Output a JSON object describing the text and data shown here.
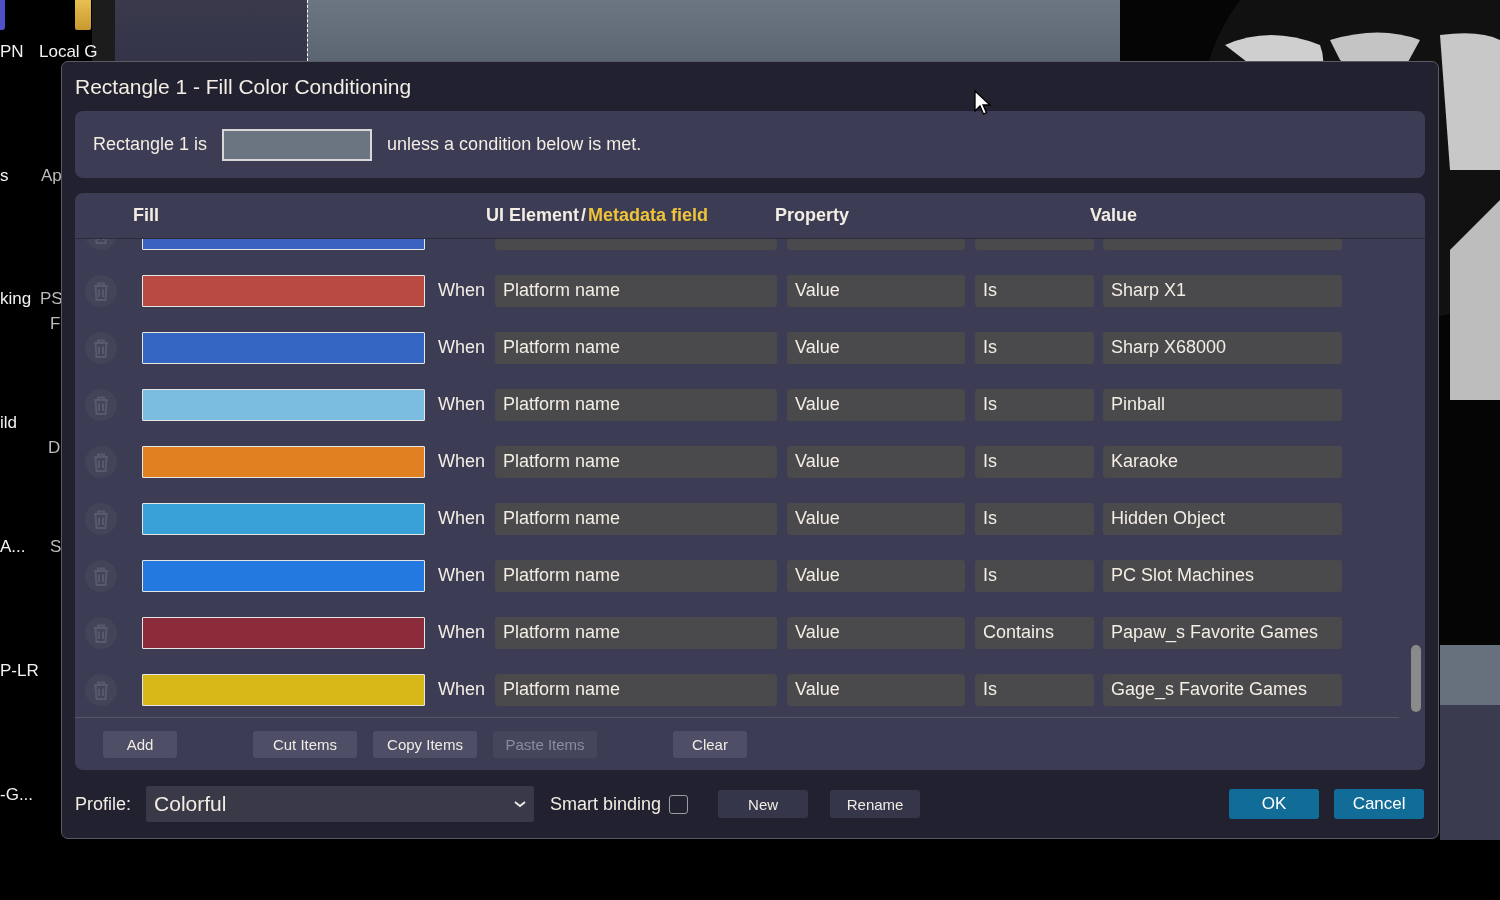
{
  "desktop": {
    "labels": [
      "PN",
      "Local G",
      "s",
      "Ap",
      "king",
      "PS",
      "F",
      "ild",
      "D",
      "A...",
      "S",
      "P-LR",
      "-G..."
    ]
  },
  "window": {
    "title": "Rectangle 1 - Fill Color Conditioning"
  },
  "default_rule": {
    "prefix": "Rectangle 1 is",
    "color": "#6b7581",
    "suffix": "unless a condition below is met."
  },
  "table": {
    "columns": {
      "fill": "Fill",
      "element": "UI Element",
      "separator": "/",
      "metadata": "Metadata field",
      "property": "Property",
      "value": "Value"
    },
    "rows": [
      {
        "color": "#3a62c0"
      },
      {
        "color": "#b94a42",
        "connector": "When",
        "element": "Platform name",
        "property": "Value",
        "operator": "Is",
        "value": "Sharp X1"
      },
      {
        "color": "#3566c4",
        "connector": "When",
        "element": "Platform name",
        "property": "Value",
        "operator": "Is",
        "value": "Sharp X68000"
      },
      {
        "color": "#7bbde0",
        "connector": "When",
        "element": "Platform name",
        "property": "Value",
        "operator": "Is",
        "value": "Pinball"
      },
      {
        "color": "#e08020",
        "connector": "When",
        "element": "Platform name",
        "property": "Value",
        "operator": "Is",
        "value": "Karaoke"
      },
      {
        "color": "#3aa0d8",
        "connector": "When",
        "element": "Platform name",
        "property": "Value",
        "operator": "Is",
        "value": "Hidden Object"
      },
      {
        "color": "#2479e0",
        "connector": "When",
        "element": "Platform name",
        "property": "Value",
        "operator": "Is",
        "value": "PC Slot Machines"
      },
      {
        "color": "#8c2c3a",
        "connector": "When",
        "element": "Platform name",
        "property": "Value",
        "operator": "Contains",
        "value": "Papaw_s Favorite Games"
      },
      {
        "color": "#d8b818",
        "connector": "When",
        "element": "Platform name",
        "property": "Value",
        "operator": "Is",
        "value": "Gage_s Favorite Games"
      }
    ]
  },
  "actions": [
    {
      "label": "Add",
      "disabled": false
    },
    {
      "label": "Cut Items",
      "disabled": false
    },
    {
      "label": "Copy Items",
      "disabled": false
    },
    {
      "label": "Paste Items",
      "disabled": true
    },
    {
      "label": "Clear",
      "disabled": false
    }
  ],
  "footer": {
    "profile_label": "Profile:",
    "profile": "Colorful",
    "smart_binding": {
      "label": "Smart binding",
      "checked": false
    },
    "buttons": [
      {
        "label": "New",
        "kind": "secondary"
      },
      {
        "label": "Rename",
        "kind": "secondary"
      },
      {
        "label": "OK",
        "kind": "primary"
      },
      {
        "label": "Cancel",
        "kind": "primary"
      }
    ]
  }
}
